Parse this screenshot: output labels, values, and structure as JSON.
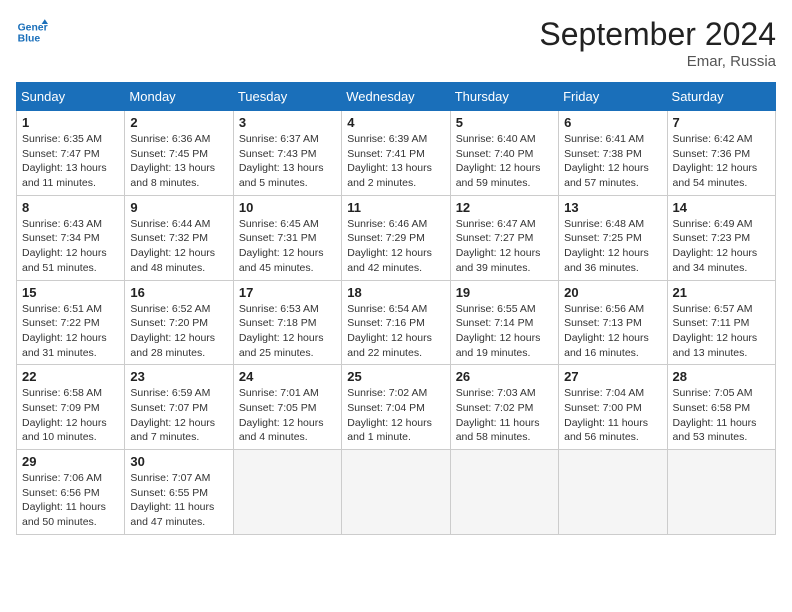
{
  "header": {
    "logo_line1": "General",
    "logo_line2": "Blue",
    "title": "September 2024",
    "subtitle": "Emar, Russia"
  },
  "columns": [
    "Sunday",
    "Monday",
    "Tuesday",
    "Wednesday",
    "Thursday",
    "Friday",
    "Saturday"
  ],
  "weeks": [
    [
      {
        "day": "1",
        "sunrise": "6:35 AM",
        "sunset": "7:47 PM",
        "daylight": "13 hours and 11 minutes."
      },
      {
        "day": "2",
        "sunrise": "6:36 AM",
        "sunset": "7:45 PM",
        "daylight": "13 hours and 8 minutes."
      },
      {
        "day": "3",
        "sunrise": "6:37 AM",
        "sunset": "7:43 PM",
        "daylight": "13 hours and 5 minutes."
      },
      {
        "day": "4",
        "sunrise": "6:39 AM",
        "sunset": "7:41 PM",
        "daylight": "13 hours and 2 minutes."
      },
      {
        "day": "5",
        "sunrise": "6:40 AM",
        "sunset": "7:40 PM",
        "daylight": "12 hours and 59 minutes."
      },
      {
        "day": "6",
        "sunrise": "6:41 AM",
        "sunset": "7:38 PM",
        "daylight": "12 hours and 57 minutes."
      },
      {
        "day": "7",
        "sunrise": "6:42 AM",
        "sunset": "7:36 PM",
        "daylight": "12 hours and 54 minutes."
      }
    ],
    [
      {
        "day": "8",
        "sunrise": "6:43 AM",
        "sunset": "7:34 PM",
        "daylight": "12 hours and 51 minutes."
      },
      {
        "day": "9",
        "sunrise": "6:44 AM",
        "sunset": "7:32 PM",
        "daylight": "12 hours and 48 minutes."
      },
      {
        "day": "10",
        "sunrise": "6:45 AM",
        "sunset": "7:31 PM",
        "daylight": "12 hours and 45 minutes."
      },
      {
        "day": "11",
        "sunrise": "6:46 AM",
        "sunset": "7:29 PM",
        "daylight": "12 hours and 42 minutes."
      },
      {
        "day": "12",
        "sunrise": "6:47 AM",
        "sunset": "7:27 PM",
        "daylight": "12 hours and 39 minutes."
      },
      {
        "day": "13",
        "sunrise": "6:48 AM",
        "sunset": "7:25 PM",
        "daylight": "12 hours and 36 minutes."
      },
      {
        "day": "14",
        "sunrise": "6:49 AM",
        "sunset": "7:23 PM",
        "daylight": "12 hours and 34 minutes."
      }
    ],
    [
      {
        "day": "15",
        "sunrise": "6:51 AM",
        "sunset": "7:22 PM",
        "daylight": "12 hours and 31 minutes."
      },
      {
        "day": "16",
        "sunrise": "6:52 AM",
        "sunset": "7:20 PM",
        "daylight": "12 hours and 28 minutes."
      },
      {
        "day": "17",
        "sunrise": "6:53 AM",
        "sunset": "7:18 PM",
        "daylight": "12 hours and 25 minutes."
      },
      {
        "day": "18",
        "sunrise": "6:54 AM",
        "sunset": "7:16 PM",
        "daylight": "12 hours and 22 minutes."
      },
      {
        "day": "19",
        "sunrise": "6:55 AM",
        "sunset": "7:14 PM",
        "daylight": "12 hours and 19 minutes."
      },
      {
        "day": "20",
        "sunrise": "6:56 AM",
        "sunset": "7:13 PM",
        "daylight": "12 hours and 16 minutes."
      },
      {
        "day": "21",
        "sunrise": "6:57 AM",
        "sunset": "7:11 PM",
        "daylight": "12 hours and 13 minutes."
      }
    ],
    [
      {
        "day": "22",
        "sunrise": "6:58 AM",
        "sunset": "7:09 PM",
        "daylight": "12 hours and 10 minutes."
      },
      {
        "day": "23",
        "sunrise": "6:59 AM",
        "sunset": "7:07 PM",
        "daylight": "12 hours and 7 minutes."
      },
      {
        "day": "24",
        "sunrise": "7:01 AM",
        "sunset": "7:05 PM",
        "daylight": "12 hours and 4 minutes."
      },
      {
        "day": "25",
        "sunrise": "7:02 AM",
        "sunset": "7:04 PM",
        "daylight": "12 hours and 1 minute."
      },
      {
        "day": "26",
        "sunrise": "7:03 AM",
        "sunset": "7:02 PM",
        "daylight": "11 hours and 58 minutes."
      },
      {
        "day": "27",
        "sunrise": "7:04 AM",
        "sunset": "7:00 PM",
        "daylight": "11 hours and 56 minutes."
      },
      {
        "day": "28",
        "sunrise": "7:05 AM",
        "sunset": "6:58 PM",
        "daylight": "11 hours and 53 minutes."
      }
    ],
    [
      {
        "day": "29",
        "sunrise": "7:06 AM",
        "sunset": "6:56 PM",
        "daylight": "11 hours and 50 minutes."
      },
      {
        "day": "30",
        "sunrise": "7:07 AM",
        "sunset": "6:55 PM",
        "daylight": "11 hours and 47 minutes."
      },
      null,
      null,
      null,
      null,
      null
    ]
  ]
}
